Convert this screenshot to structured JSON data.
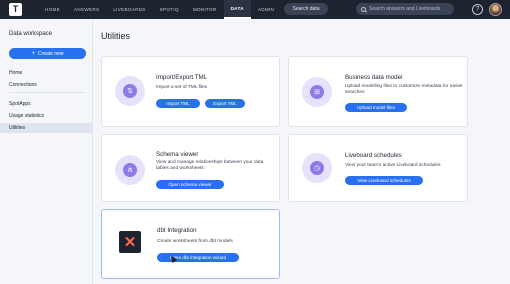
{
  "topbar": {
    "logo": "T",
    "nav": [
      "HOME",
      "ANSWERS",
      "LIVEBOARDS",
      "SPOTIQ",
      "MONITOR",
      "DATA",
      "ADMIN",
      "DEVELOP"
    ],
    "active_nav": "DATA",
    "search_data_label": "Search data",
    "search_placeholder": "Search answers and Liveboards",
    "help_label": "?"
  },
  "sidebar": {
    "title": "Data workspace",
    "create_label": "Create new",
    "items": [
      "Home",
      "Connections",
      "SpotApps",
      "Usage statistics",
      "Utilities"
    ],
    "active_item": "Utilities"
  },
  "main": {
    "title": "Utilities",
    "cards": [
      {
        "title": "Import/Export TML",
        "desc": "Import a set of TML files",
        "buttons": [
          "Import TML",
          "Export TML"
        ]
      },
      {
        "title": "Business data model",
        "desc": "Upload modelling files to customize metadata for easier searches",
        "buttons": [
          "Upload model files"
        ]
      },
      {
        "title": "Schema viewer",
        "desc": "View and manage relationships between your data tables and worksheets",
        "buttons": [
          "Open schema viewer"
        ]
      },
      {
        "title": "Liveboard schedules",
        "desc": "View your team's active Liveboard schedules",
        "buttons": [
          "View Liveboard schedules"
        ]
      },
      {
        "title": "dbt Integration",
        "desc": "Create worksheets from dbt models",
        "buttons": [
          "Open dbt integration wizard"
        ]
      }
    ]
  },
  "colors": {
    "nav_bg": "#1d232f",
    "accent": "#2770ef",
    "illustration": "#8c7ae6",
    "dbt": "#ff694a"
  },
  "icons": {
    "import_export": "document-arrows-icon",
    "business_model": "grid-squares-icon",
    "schema": "hierarchy-icon",
    "schedules": "clock-icon",
    "dbt": "dbt-logo-icon"
  }
}
